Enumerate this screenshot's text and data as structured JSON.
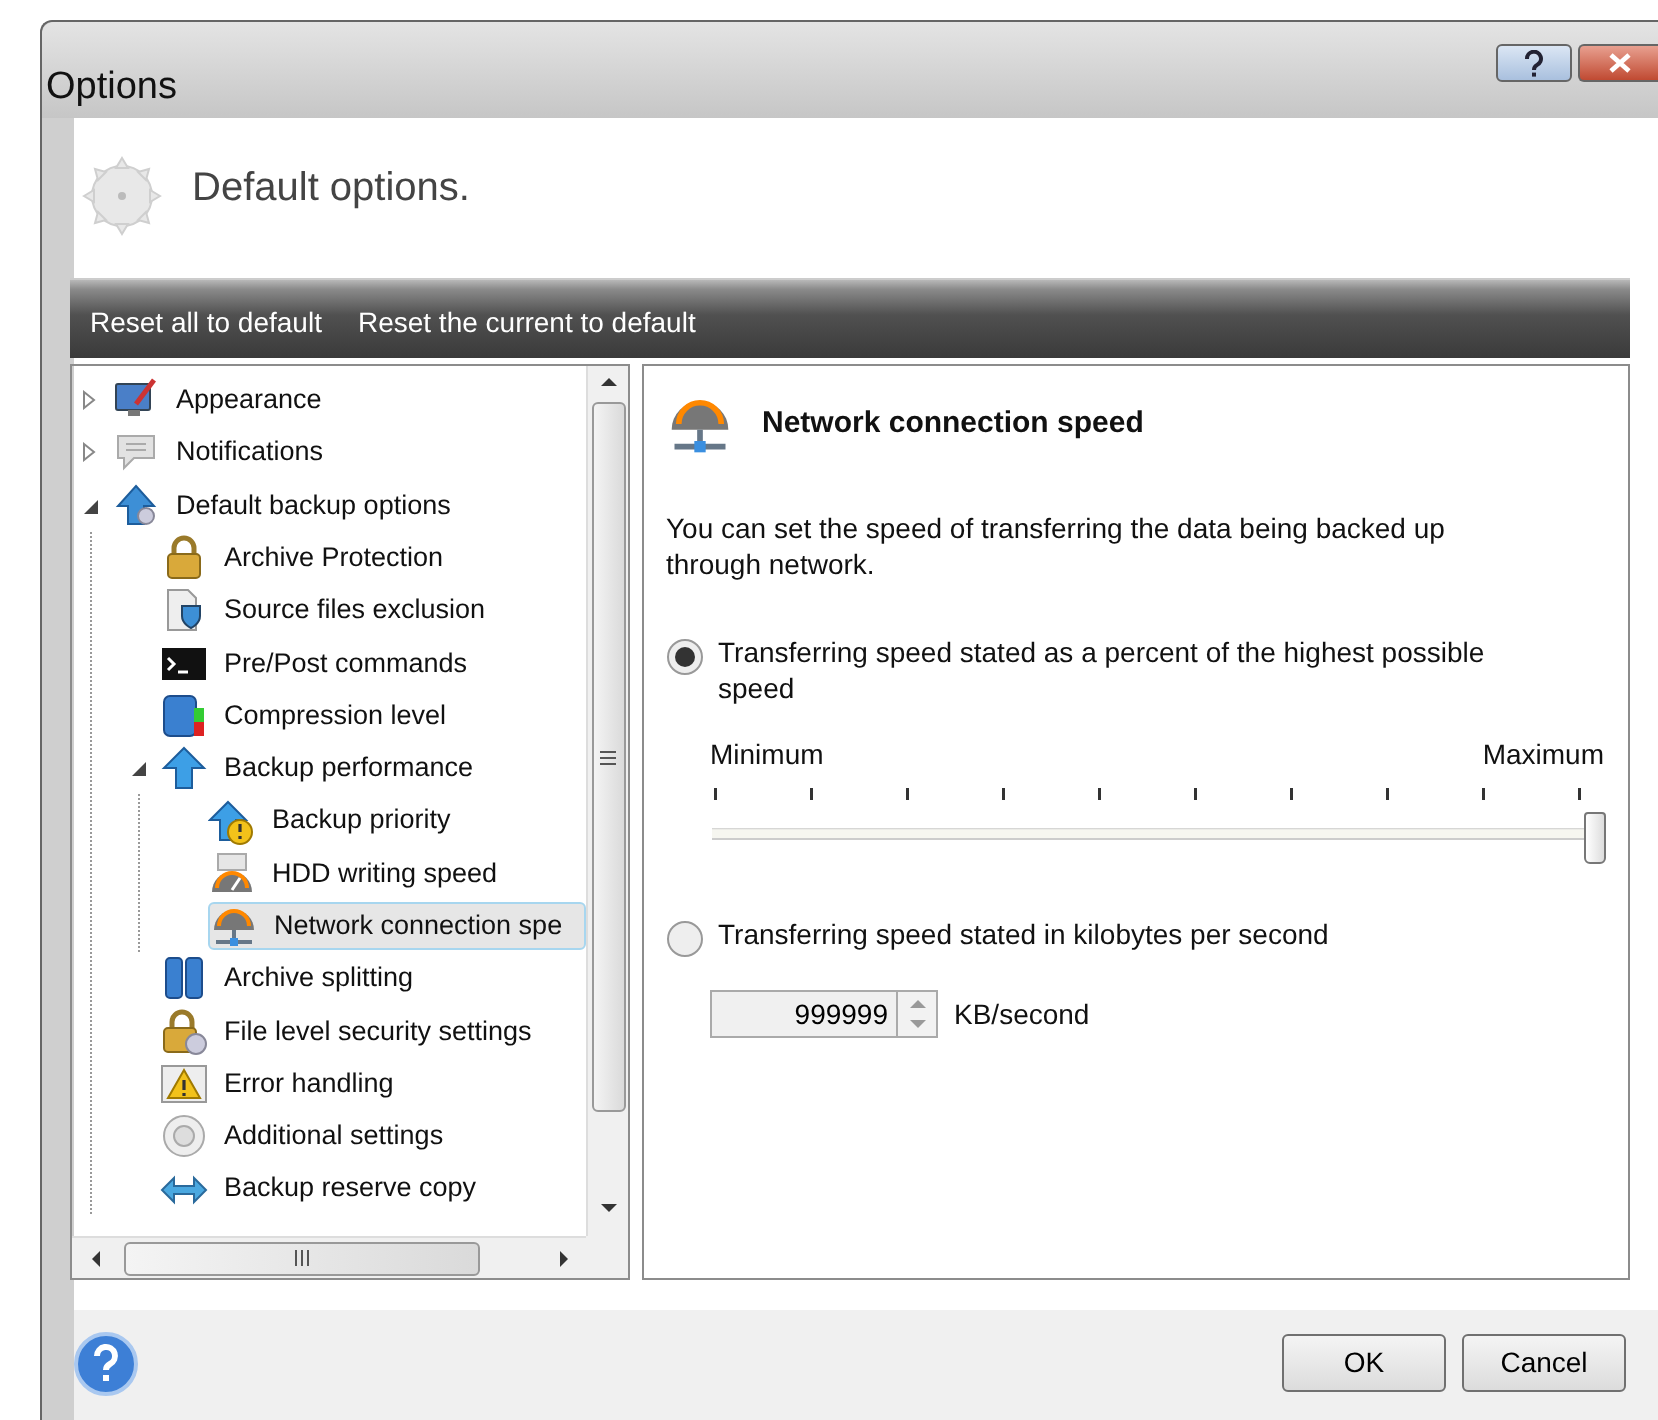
{
  "window": {
    "title": "Options"
  },
  "header": {
    "title": "Default options."
  },
  "toolbar": [
    "Reset all to default",
    "Reset the current to default"
  ],
  "tree": [
    {
      "label": "Appearance",
      "expanded": false,
      "selected": false
    },
    {
      "label": "Notifications",
      "expanded": false,
      "selected": false
    },
    {
      "label": "Default backup options",
      "expanded": true,
      "selected": false,
      "children": [
        {
          "label": "Archive Protection",
          "selected": false
        },
        {
          "label": "Source files exclusion",
          "selected": false
        },
        {
          "label": "Pre/Post commands",
          "selected": false
        },
        {
          "label": "Compression level",
          "selected": false
        },
        {
          "label": "Backup performance",
          "expanded": true,
          "selected": false,
          "children": [
            {
              "label": "Backup priority",
              "selected": false
            },
            {
              "label": "HDD writing speed",
              "selected": false
            },
            {
              "label": "Network connection spe",
              "selected": true
            }
          ]
        },
        {
          "label": "Archive splitting",
          "selected": false
        },
        {
          "label": "File level security settings",
          "selected": false
        },
        {
          "label": "Error handling",
          "selected": false
        },
        {
          "label": "Additional settings",
          "selected": false
        },
        {
          "label": "Backup reserve copy",
          "selected": false
        }
      ]
    }
  ],
  "panel": {
    "title": "Network connection speed",
    "description": "You can set the speed of transferring the data being backed up through network.",
    "options": [
      {
        "kind": "slider",
        "label": "Transferring speed stated as a percent of the highest possible speed",
        "selected": true,
        "slider": {
          "min_label": "Minimum",
          "max_label": "Maximum",
          "level": 1
        }
      },
      {
        "kind": "spin",
        "label": "Transferring speed stated in kilobytes per second",
        "selected": false,
        "spin": {
          "value": "999999",
          "unit": "KB/second",
          "disabled": true
        }
      }
    ]
  },
  "buttons": [
    "OK",
    "Cancel"
  ]
}
